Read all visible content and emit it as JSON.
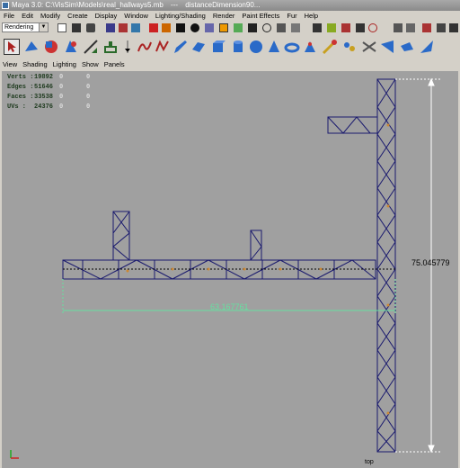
{
  "window": {
    "title": "Maya 3.0: C:\\VisSim\\Models\\real_hallways5.mb",
    "separator": "---",
    "selection": "distanceDimension90..."
  },
  "menubar": [
    "File",
    "Edit",
    "Modify",
    "Create",
    "Display",
    "Window",
    "Lighting/Shading",
    "Render",
    "Paint Effects",
    "Fur",
    "Help"
  ],
  "shelf": {
    "mode": "Rendering"
  },
  "panel_menu": [
    "View",
    "Shading",
    "Lighting",
    "Show",
    "Panels"
  ],
  "hud": {
    "rows": [
      {
        "label": "Verts :",
        "value": "19892",
        "z1": "0",
        "z2": "0"
      },
      {
        "label": "Edges :",
        "value": "51646",
        "z1": "0",
        "z2": "0"
      },
      {
        "label": "Faces :",
        "value": "33538",
        "z1": "0",
        "z2": "0"
      },
      {
        "label": "UVs :",
        "value": "24376",
        "z1": "0",
        "z2": "0"
      }
    ]
  },
  "viewport": {
    "camera": "top",
    "dimension_horizontal": "63.167761",
    "dimension_vertical": "75.045779",
    "colors": {
      "background": "#a0a0a0",
      "wire": "#1a1a6e",
      "dim_h": "#66e0a0",
      "dim_v": "#ffffff"
    }
  }
}
